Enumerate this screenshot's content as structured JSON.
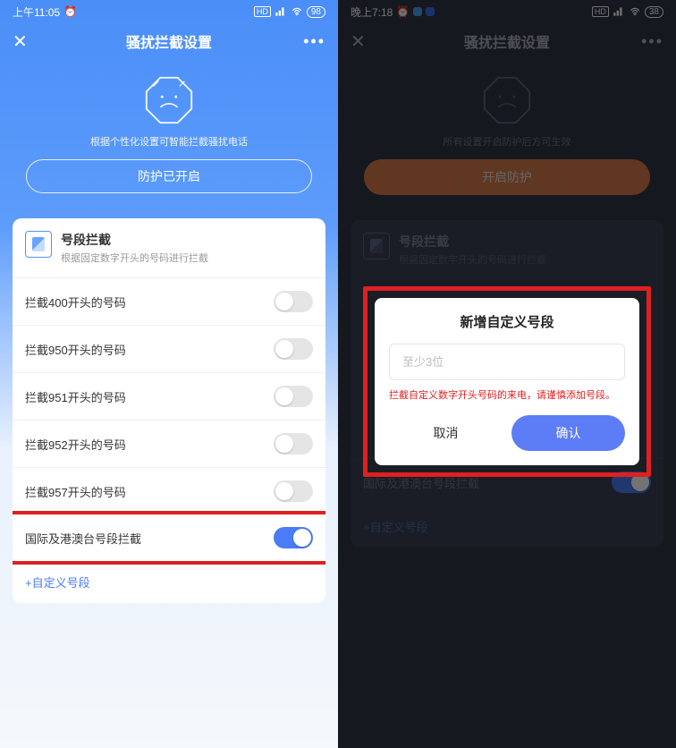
{
  "left": {
    "status": {
      "time": "上午11:05",
      "alarm": "⏰",
      "hd": "HD",
      "signal": "📶",
      "wifi": "📶",
      "battery": "98"
    },
    "titlebar": {
      "title": "骚扰拦截设置"
    },
    "hero": {
      "desc": "根据个性化设置可智能拦截骚扰电话",
      "btn": "防护已开启"
    },
    "card": {
      "title": "号段拦截",
      "desc": "根据固定数字开头的号码进行拦截",
      "rows": [
        {
          "label": "拦截400开头的号码",
          "on": false
        },
        {
          "label": "拦截950开头的号码",
          "on": false
        },
        {
          "label": "拦截951开头的号码",
          "on": false
        },
        {
          "label": "拦截952开头的号码",
          "on": false
        },
        {
          "label": "拦截957开头的号码",
          "on": false
        }
      ],
      "intl": {
        "label": "国际及港澳台号段拦截",
        "on": true
      },
      "add": "+自定义号段"
    }
  },
  "right": {
    "status": {
      "time": "晚上7:18",
      "alarm": "⏰",
      "hd": "HD",
      "battery": "38"
    },
    "titlebar": {
      "title": "骚扰拦截设置"
    },
    "hero": {
      "desc": "所有设置开启防护后方可生效",
      "btn": "开启防护"
    },
    "card": {
      "title": "号段拦截",
      "desc": "根据固定数字开头的号码进行拦截",
      "intl_label": "国际及港澳台号段拦截",
      "add": "+自定义号段"
    },
    "dialog": {
      "title": "新增自定义号段",
      "placeholder": "至少3位",
      "warning": "拦截自定义数字开头号码的来电，请谨慎添加号段。",
      "cancel": "取消",
      "confirm": "确认"
    }
  }
}
